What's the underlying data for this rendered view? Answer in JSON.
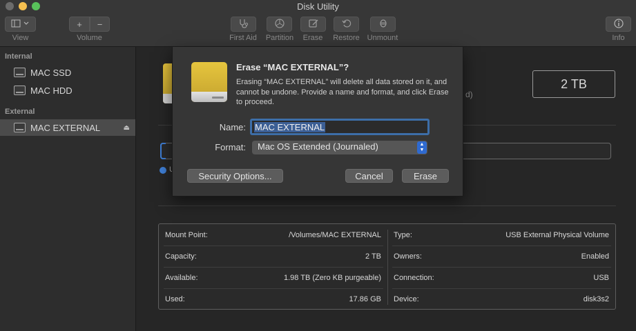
{
  "window": {
    "title": "Disk Utility"
  },
  "toolbar": {
    "view_label": "View",
    "volume_label": "Volume",
    "first_aid_label": "First Aid",
    "partition_label": "Partition",
    "erase_label": "Erase",
    "restore_label": "Restore",
    "unmount_label": "Unmount",
    "info_label": "Info",
    "add_glyph": "+",
    "remove_glyph": "−"
  },
  "sidebar": {
    "internal_header": "Internal",
    "external_header": "External",
    "items": [
      {
        "label": "MAC SSD",
        "section": "Internal"
      },
      {
        "label": "MAC HDD",
        "section": "Internal"
      },
      {
        "label": "MAC EXTERNAL",
        "section": "External",
        "selected": true
      }
    ]
  },
  "main": {
    "capacity_box": "2 TB",
    "partial_text": "d)",
    "legend_partial": "U"
  },
  "info": {
    "left": [
      {
        "key": "Mount Point:",
        "value": "/Volumes/MAC EXTERNAL"
      },
      {
        "key": "Capacity:",
        "value": "2 TB"
      },
      {
        "key": "Available:",
        "value": "1.98 TB (Zero KB purgeable)"
      },
      {
        "key": "Used:",
        "value": "17.86 GB"
      }
    ],
    "right": [
      {
        "key": "Type:",
        "value": "USB External Physical Volume"
      },
      {
        "key": "Owners:",
        "value": "Enabled"
      },
      {
        "key": "Connection:",
        "value": "USB"
      },
      {
        "key": "Device:",
        "value": "disk3s2"
      }
    ]
  },
  "dialog": {
    "title": "Erase “MAC EXTERNAL”?",
    "message": "Erasing “MAC EXTERNAL” will delete all data stored on it, and cannot be undone. Provide a name and format, and click Erase to proceed.",
    "name_label": "Name:",
    "name_value": "MAC EXTERNAL",
    "format_label": "Format:",
    "format_value": "Mac OS Extended (Journaled)",
    "security_button": "Security Options...",
    "cancel_button": "Cancel",
    "erase_button": "Erase"
  },
  "colors": {
    "accent": "#3f7fd6",
    "disk_yellow": "#e6c33c",
    "window_bg": "#262626"
  }
}
